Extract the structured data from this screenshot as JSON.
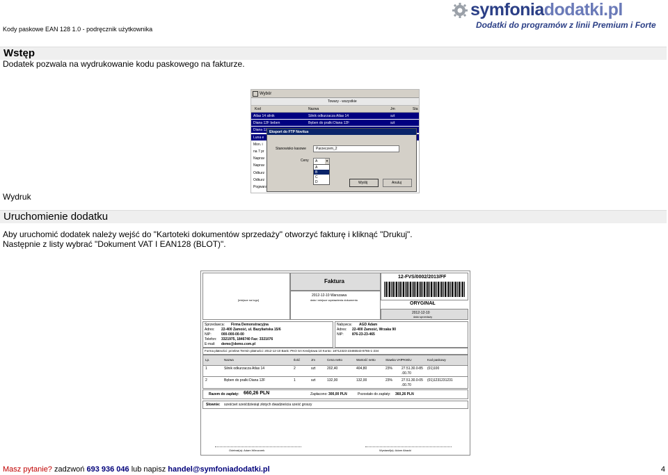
{
  "header": {
    "doc_title": "Kody paskowe EAN 128 1.0  - podręcznik użytkownika",
    "logo_part1": "symfonia",
    "logo_part2": "dodatki.pl",
    "logo_tagline": "Dodatki do programów z linii Premium i Forte"
  },
  "sections": {
    "intro_title": "Wstęp",
    "intro_text": "Dodatek pozwala na wydrukowanie kodu paskowego na fakturze.",
    "caption_print": "Wydruk",
    "launch_title": "Uruchomienie dodatku",
    "launch_line1": "Aby uruchomić dodatek należy wejść do \"Kartoteki dokumentów sprzedaży\" otworzyć fakturę i kliknąć \"Drukuj\".",
    "launch_line2": "Następnie z listy wybrać \"Dokument VAT I EAN128 (BLOT)\"."
  },
  "screenshot_dialog": {
    "window_title": "Wybór",
    "list_title": "Towary - wszystkie",
    "col_kod": "Kod",
    "col_nazwa": "Nazwa",
    "col_jm": "Jm",
    "col_sta": "Sta",
    "rows": [
      {
        "kod": "Atlas 14 silnik",
        "nazwa": "Silnik odkurzacza Atlas 14",
        "jm": "szt"
      },
      {
        "kod": "Diana 12F beben",
        "nazwa": "Bęben do pralki Diana 12F",
        "jm": "szt"
      },
      {
        "kod": "Diana 12F",
        "nazwa": "",
        "jm": ""
      },
      {
        "kod": "Luna e",
        "nazwa": "",
        "jm": ""
      },
      {
        "kod": "Mon. i",
        "nazwa": "",
        "jm": ""
      },
      {
        "kod": "na 7 pr",
        "nazwa": "",
        "jm": ""
      },
      {
        "kod": "Naprav",
        "nazwa": "",
        "jm": ""
      },
      {
        "kod": "Naprav",
        "nazwa": "",
        "jm": ""
      },
      {
        "kod": "Odkurz",
        "nazwa": "",
        "jm": ""
      },
      {
        "kod": "Odkurz",
        "nazwa": "",
        "jm": ""
      },
      {
        "kod": "Pogwarancyjny przegl",
        "nazwa": "Przegląd pogwarancyjny",
        "jm": "szt"
      }
    ],
    "dialog_title": "Eksport do FTP Novitus",
    "label_stanowisko": "Stanowisko kasowe",
    "stanowisko_value": "Parzeczem_2",
    "label_ceny": "Ceny",
    "ceny_value": "A",
    "ceny_options": [
      "A",
      "B",
      "C",
      "D"
    ],
    "btn_wyslij": "Wyślij",
    "btn_anuluj": "Anuluj"
  },
  "screenshot_invoice": {
    "title": "Faktura",
    "number": "12-FVS/0002/2013/FF",
    "logo_placeholder": "[miejsce na logo]",
    "date_place": "2012-12-10  Warszawa",
    "date_caption": "data i miejsce wystawienia dokumentu",
    "original": "ORYGINAŁ",
    "sale_date": "2012-12-10",
    "sale_date_caption": "data sprzedaży",
    "seller_label": "Sprzedawca:",
    "seller_name": "Firma Demonstracyjna",
    "seller_addr_label": "Adres:",
    "seller_addr": "22-400 Zamość, ul. Bazyliańska 15/6",
    "seller_nip_label": "NIP:",
    "seller_nip": "000-000-00-00",
    "seller_tel_label": "Telefon:",
    "seller_tel": "3321975, 1846740   Fax: 3321076",
    "seller_email_label": "E-mail:",
    "seller_email": "demo@demo.com.pl",
    "buyer_label": "Nabywca:",
    "buyer_name": "AGD Adam",
    "buyer_addr_label": "Adres:",
    "buyer_addr": "22-400 Zamość, Wrzaka 90",
    "buyer_nip_label": "NIP:",
    "buyer_nip": "876-23-23-465",
    "pay_line": "Forma płatności: przelew   Termin płatności: 2012-12-10   Bank: PKO SA Kredytowa 10   Konto: 18712323-23465543-8765-1-234",
    "cols": [
      "Lp.",
      "Nazwa",
      "Ilość",
      "Jm",
      "Cena netto",
      "Wartość netto",
      "Stawka VAT",
      "PKWiU",
      "Kod paskowy"
    ],
    "items": [
      {
        "lp": "1",
        "nazwa": "Silnik odkurzacza Atlas 14",
        "ilosc": "2",
        "jm": "szt",
        "cena": "202,40",
        "wartosc": "404,80",
        "vat": "23%",
        "pkwiu": "27.51.30.0-85",
        "ean": "(01)100"
      },
      {
        "lp": "2",
        "nazwa": "Bęben do pralki Diana 12F",
        "ilosc": "1",
        "jm": "szt",
        "cena": "132,00",
        "wartosc": "132,00",
        "vat": "23%",
        "pkwiu": "27.51.30.0-05",
        "ean": "(01)1231231231"
      }
    ],
    "pkwiu_suffix1": ".00.70",
    "pkwiu_suffix2": ".00.70",
    "to_pay_label": "Razem do zapłaty:",
    "to_pay": "660,26 PLN",
    "paid_label": "Zapłacono:",
    "paid": "300,00 PLN",
    "left_label": "Pozostało do zapłaty:",
    "left": "360,26 PLN",
    "words_label": "Słownie:",
    "words": "sześćset sześćdziesiąt złotych dwadzieścia sześć groszy",
    "sig_left": "Odebrał(a): Adam Wieczorek",
    "sig_right": "Wystawił(a): Adam Abacki"
  },
  "footer": {
    "question": "Masz pytanie?",
    "call": " zadzwoń ",
    "phone": "693 936 046",
    "or_write": " lub napisz ",
    "email": "handel@symfoniadodatki.pl",
    "page": "4"
  },
  "colors": {
    "brand_dark": "#2b3f86",
    "brand_light": "#6a7ab8",
    "footer_red": "#c00000",
    "selection_blue": "#000080",
    "dialog_title_blue": "#0a246a"
  }
}
